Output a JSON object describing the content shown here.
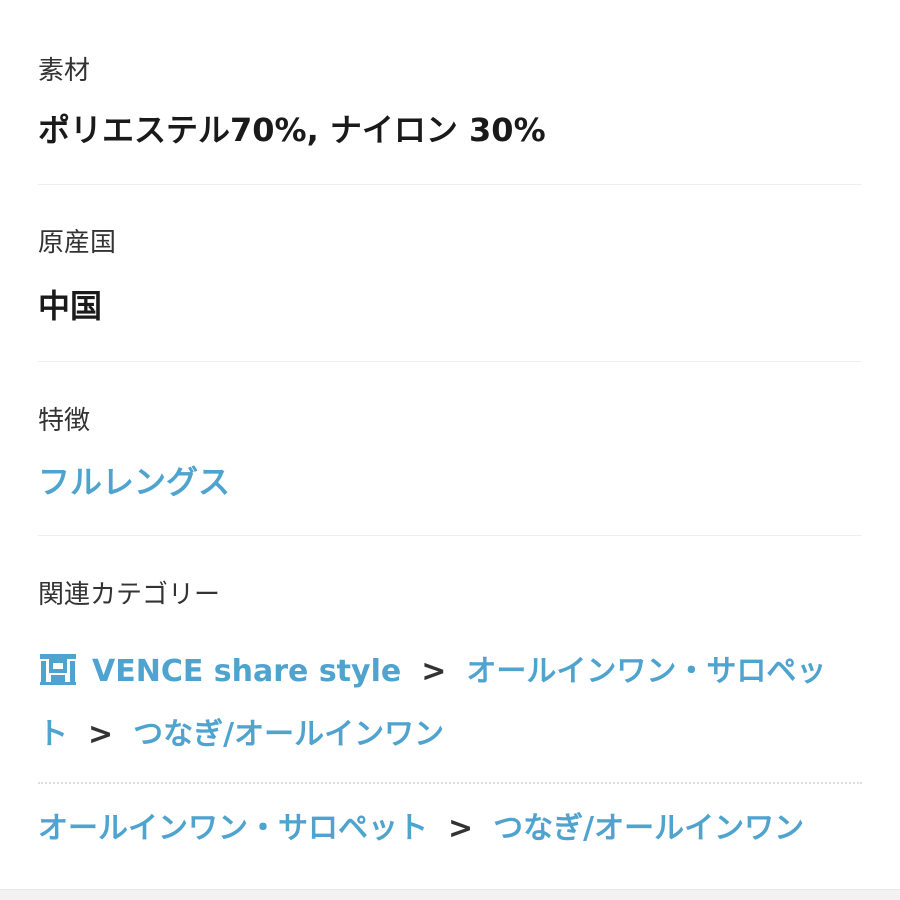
{
  "material": {
    "label": "素材",
    "value": "ポリエステル70%, ナイロン 30%"
  },
  "origin": {
    "label": "原産国",
    "value": "中国"
  },
  "features": {
    "label": "特徴",
    "value": "フルレングス"
  },
  "categories": {
    "label": "関連カテゴリー",
    "path1": {
      "store_icon": "store-icon",
      "store": "VENCE share style",
      "sep1": ">",
      "cat1_line1": "オールインワン・サロペッ",
      "cat1_line2": "ト",
      "sep2": ">",
      "cat2": "つなぎ/オールインワン"
    },
    "path2": {
      "cat1": "オールインワン・サロペット",
      "sep": ">",
      "cat2": "つなぎ/オールインワン"
    }
  },
  "colors": {
    "link": "#4fa3cf",
    "text": "#1a1a1a",
    "label": "#333333"
  }
}
